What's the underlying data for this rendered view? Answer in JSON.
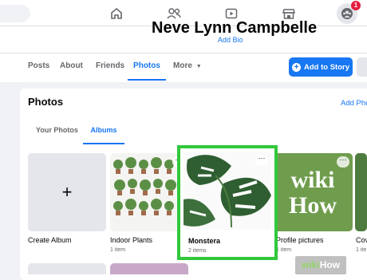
{
  "notifications_count": "1",
  "profile": {
    "name": "Neve Lynn Campbelle",
    "add_bio": "Add Bio"
  },
  "profile_tabs": [
    "Posts",
    "About",
    "Friends",
    "Photos",
    "More"
  ],
  "add_story_label": "Add to Story",
  "photos_section": {
    "title": "Photos",
    "add_photos": "Add Pho",
    "subtabs": [
      "Your Photos",
      "Albums"
    ]
  },
  "albums": [
    {
      "name": "Create Album",
      "count": ""
    },
    {
      "name": "Indoor Plants",
      "count": "1 item"
    },
    {
      "name": "Monstera",
      "count": "2 items"
    },
    {
      "name": "Profile pictures",
      "count": "1 item"
    },
    {
      "name": "Cov",
      "count": "1 ite"
    }
  ],
  "watermark": {
    "part1": "wiki",
    "part2": "How"
  },
  "icons": [
    "home-icon",
    "friends-icon",
    "watch-icon",
    "marketplace-icon",
    "groups-icon",
    "chevron-down-icon",
    "plus-icon"
  ],
  "colors": {
    "accent": "#1877f2",
    "highlight": "#31c83b",
    "leaf": "#2e5e31"
  }
}
